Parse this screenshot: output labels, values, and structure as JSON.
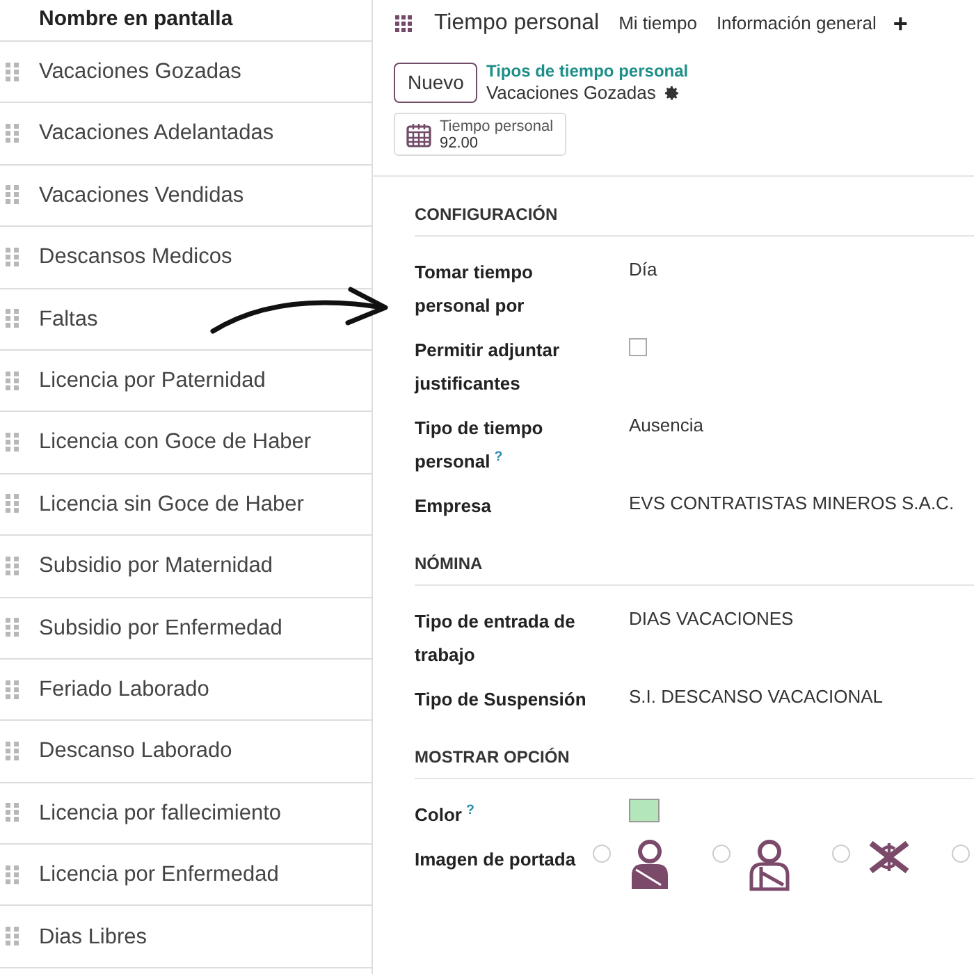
{
  "list": {
    "header": "Nombre en pantalla",
    "rows": [
      {
        "name": "Vacaciones Gozadas"
      },
      {
        "name": "Vacaciones Adelantadas"
      },
      {
        "name": "Vacaciones Vendidas"
      },
      {
        "name": "Descansos Medicos"
      },
      {
        "name": "Faltas"
      },
      {
        "name": "Licencia por Paternidad"
      },
      {
        "name": "Licencia con Goce de Haber"
      },
      {
        "name": "Licencia sin Goce de Haber"
      },
      {
        "name": "Subsidio por Maternidad"
      },
      {
        "name": "Subsidio por Enfermedad"
      },
      {
        "name": "Feriado Laborado"
      },
      {
        "name": "Descanso Laborado"
      },
      {
        "name": "Licencia por fallecimiento"
      },
      {
        "name": "Licencia por Enfermedad"
      },
      {
        "name": "Dias Libres"
      }
    ]
  },
  "navbar": {
    "app": "Tiempo personal",
    "menus": [
      "Mi tiempo",
      "Información general",
      "+"
    ]
  },
  "control_panel": {
    "new_button": "Nuevo",
    "breadcrumb": "Tipos de tiempo personal",
    "record": "Vacaciones Gozadas"
  },
  "stat_button": {
    "label": "Tiempo personal",
    "value": "92.00"
  },
  "sections": [
    {
      "title": "CONFIGURACIÓN",
      "fields": [
        {
          "kind": "text",
          "label": "Tomar tiempo personal por",
          "value": "Día"
        },
        {
          "kind": "checkbox",
          "label": "Permitir adjuntar justificantes",
          "checked": false
        },
        {
          "kind": "text",
          "label": "Tipo de tiempo personal",
          "help": "?",
          "value": "Ausencia"
        },
        {
          "kind": "text",
          "label": "Empresa",
          "value": "EVS CONTRATISTAS MINEROS S.A.C."
        }
      ]
    },
    {
      "title": "NÓMINA",
      "fields": [
        {
          "kind": "text",
          "label": "Tipo de entrada de trabajo",
          "value": "DIAS VACACIONES"
        },
        {
          "kind": "text",
          "label": "Tipo de Suspensión",
          "value": "S.I. DESCANSO VACACIONAL"
        }
      ]
    },
    {
      "title": "MOSTRAR OPCIÓN",
      "fields": [
        {
          "kind": "color",
          "label": "Color",
          "help": "?",
          "color": "#b3e6b9"
        },
        {
          "kind": "images",
          "label": "Imagen de portada",
          "options": [
            {
              "selected": false
            },
            {
              "selected": false
            },
            {
              "selected": false
            },
            {
              "selected": false
            }
          ]
        }
      ]
    }
  ]
}
